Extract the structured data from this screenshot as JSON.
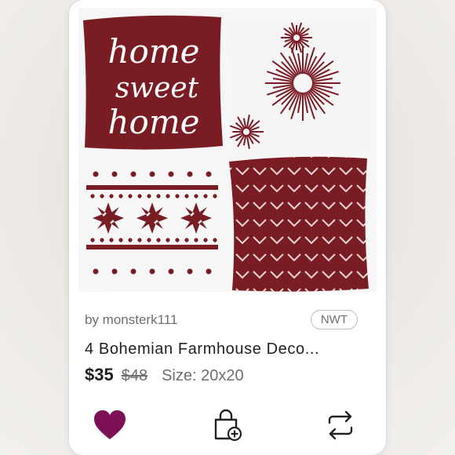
{
  "listing": {
    "seller": "by monsterk111",
    "condition_badge": "NWT",
    "title": "4 Bohemian Farmhouse Deco...",
    "price": "$35",
    "original_price": "$48",
    "size": "Size: 20x20"
  },
  "image": {
    "pillow_texts": [
      "home",
      "sweet",
      "home"
    ]
  },
  "icons": {
    "like": "heart-icon",
    "bundle": "bag-plus-icon",
    "share": "share-arrows-icon"
  },
  "colors": {
    "burgundy": "#7a1c24",
    "like_active": "#7d0f55",
    "text_dark": "#1f1f1f",
    "text_muted": "#6e6e6e"
  }
}
